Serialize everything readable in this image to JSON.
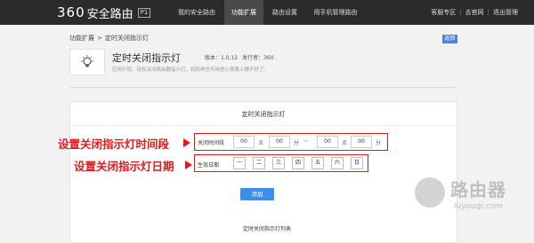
{
  "brand": {
    "logo_num": "360",
    "logo_text": "安全路由",
    "badge": "P1"
  },
  "nav": {
    "tabs": [
      "我的安全路由",
      "功能扩展",
      "路由设置",
      "用手机管理路由"
    ],
    "active_index": 1
  },
  "toplinks": [
    "客服专区",
    "去官网",
    "退出管理"
  ],
  "breadcrumb": {
    "parent": "功能扩展",
    "sep": ">",
    "current": "定时关闭指示灯"
  },
  "back_label": "返回",
  "app": {
    "title": "定时关闭指示灯",
    "version": "版本：1.0.12",
    "publisher": "发行者：360",
    "desc": "应用介绍：轻松关闭路由器指示灯，妈妈再也不用担心我晚上睡不好了。"
  },
  "panel": {
    "title": "定时关闭指示灯",
    "time_label": "关闭时间段",
    "start_hour": "00",
    "start_min": "00",
    "end_hour": "00",
    "end_min": "00",
    "unit_hour": "点",
    "unit_min": "分",
    "range_sep": "~",
    "date_label": "生效日期",
    "days": [
      "一",
      "二",
      "三",
      "四",
      "五",
      "六",
      "日"
    ],
    "add_label": "添加",
    "list_title": "定时关闭指示灯列表"
  },
  "annotations": {
    "time_range": "设置关闭指示灯时间段",
    "date": "设置关闭指示灯日期"
  },
  "watermark": {
    "text": "路由器",
    "sub": "luyouqi.com"
  },
  "colors": {
    "annotation_red": "#e8161b",
    "primary_blue": "#3d8eea",
    "topbar": "#2b2b2b"
  }
}
